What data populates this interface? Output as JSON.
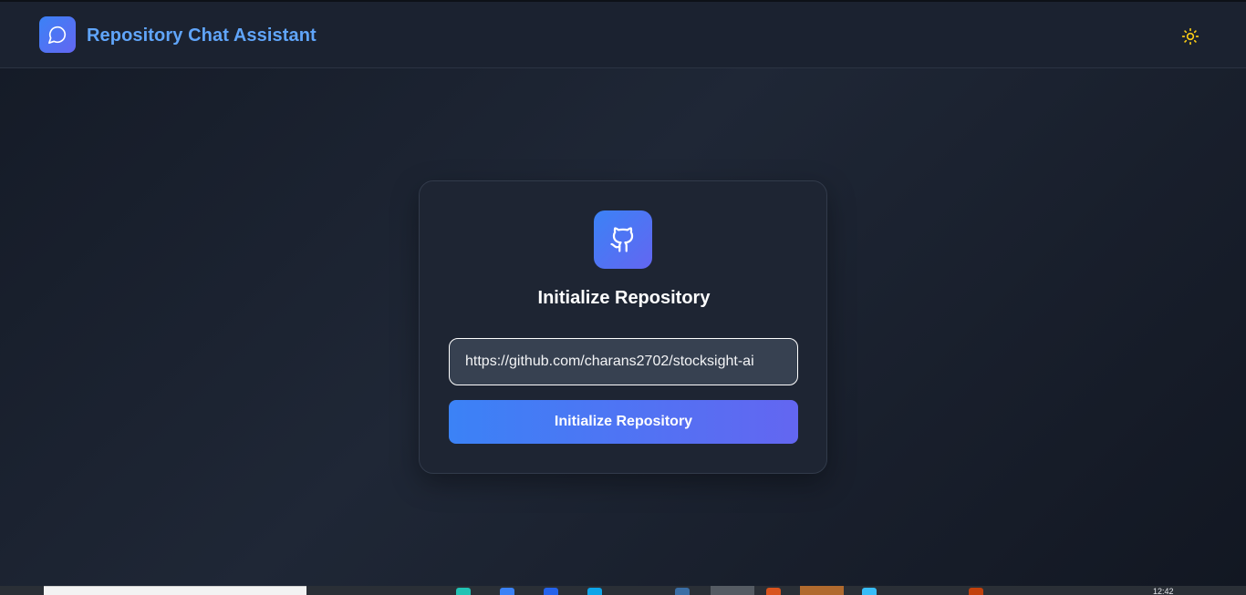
{
  "header": {
    "app_title": "Repository Chat Assistant",
    "logo_icon": "chat-bubble-icon",
    "theme_toggle_icon": "sun-icon"
  },
  "card": {
    "icon": "github-icon",
    "title": "Initialize Repository",
    "repo_input_value": "https://github.com/charans2702/stocksight-ai",
    "button_label": "Initialize Repository"
  },
  "taskbar": {
    "clock": "12:42"
  },
  "colors": {
    "accent_start": "#3b82f6",
    "accent_end": "#6366f1",
    "title_blue": "#60a5fa",
    "sun_yellow": "#facc15"
  }
}
